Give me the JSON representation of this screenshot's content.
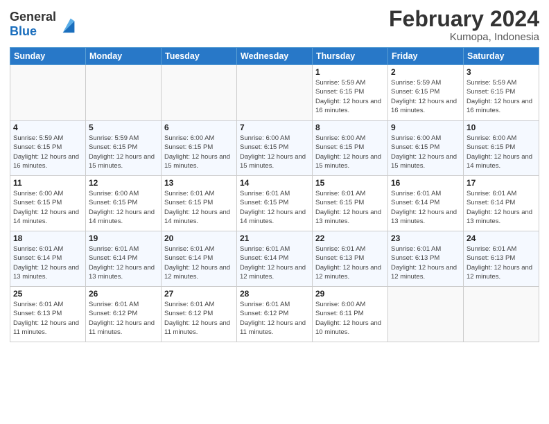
{
  "header": {
    "logo_line1": "General",
    "logo_line2": "Blue",
    "month_year": "February 2024",
    "location": "Kumopa, Indonesia"
  },
  "weekdays": [
    "Sunday",
    "Monday",
    "Tuesday",
    "Wednesday",
    "Thursday",
    "Friday",
    "Saturday"
  ],
  "weeks": [
    [
      {
        "day": "",
        "sunrise": "",
        "sunset": "",
        "daylight": ""
      },
      {
        "day": "",
        "sunrise": "",
        "sunset": "",
        "daylight": ""
      },
      {
        "day": "",
        "sunrise": "",
        "sunset": "",
        "daylight": ""
      },
      {
        "day": "",
        "sunrise": "",
        "sunset": "",
        "daylight": ""
      },
      {
        "day": "1",
        "sunrise": "Sunrise: 5:59 AM",
        "sunset": "Sunset: 6:15 PM",
        "daylight": "Daylight: 12 hours and 16 minutes."
      },
      {
        "day": "2",
        "sunrise": "Sunrise: 5:59 AM",
        "sunset": "Sunset: 6:15 PM",
        "daylight": "Daylight: 12 hours and 16 minutes."
      },
      {
        "day": "3",
        "sunrise": "Sunrise: 5:59 AM",
        "sunset": "Sunset: 6:15 PM",
        "daylight": "Daylight: 12 hours and 16 minutes."
      }
    ],
    [
      {
        "day": "4",
        "sunrise": "Sunrise: 5:59 AM",
        "sunset": "Sunset: 6:15 PM",
        "daylight": "Daylight: 12 hours and 16 minutes."
      },
      {
        "day": "5",
        "sunrise": "Sunrise: 5:59 AM",
        "sunset": "Sunset: 6:15 PM",
        "daylight": "Daylight: 12 hours and 15 minutes."
      },
      {
        "day": "6",
        "sunrise": "Sunrise: 6:00 AM",
        "sunset": "Sunset: 6:15 PM",
        "daylight": "Daylight: 12 hours and 15 minutes."
      },
      {
        "day": "7",
        "sunrise": "Sunrise: 6:00 AM",
        "sunset": "Sunset: 6:15 PM",
        "daylight": "Daylight: 12 hours and 15 minutes."
      },
      {
        "day": "8",
        "sunrise": "Sunrise: 6:00 AM",
        "sunset": "Sunset: 6:15 PM",
        "daylight": "Daylight: 12 hours and 15 minutes."
      },
      {
        "day": "9",
        "sunrise": "Sunrise: 6:00 AM",
        "sunset": "Sunset: 6:15 PM",
        "daylight": "Daylight: 12 hours and 15 minutes."
      },
      {
        "day": "10",
        "sunrise": "Sunrise: 6:00 AM",
        "sunset": "Sunset: 6:15 PM",
        "daylight": "Daylight: 12 hours and 14 minutes."
      }
    ],
    [
      {
        "day": "11",
        "sunrise": "Sunrise: 6:00 AM",
        "sunset": "Sunset: 6:15 PM",
        "daylight": "Daylight: 12 hours and 14 minutes."
      },
      {
        "day": "12",
        "sunrise": "Sunrise: 6:00 AM",
        "sunset": "Sunset: 6:15 PM",
        "daylight": "Daylight: 12 hours and 14 minutes."
      },
      {
        "day": "13",
        "sunrise": "Sunrise: 6:01 AM",
        "sunset": "Sunset: 6:15 PM",
        "daylight": "Daylight: 12 hours and 14 minutes."
      },
      {
        "day": "14",
        "sunrise": "Sunrise: 6:01 AM",
        "sunset": "Sunset: 6:15 PM",
        "daylight": "Daylight: 12 hours and 14 minutes."
      },
      {
        "day": "15",
        "sunrise": "Sunrise: 6:01 AM",
        "sunset": "Sunset: 6:15 PM",
        "daylight": "Daylight: 12 hours and 13 minutes."
      },
      {
        "day": "16",
        "sunrise": "Sunrise: 6:01 AM",
        "sunset": "Sunset: 6:14 PM",
        "daylight": "Daylight: 12 hours and 13 minutes."
      },
      {
        "day": "17",
        "sunrise": "Sunrise: 6:01 AM",
        "sunset": "Sunset: 6:14 PM",
        "daylight": "Daylight: 12 hours and 13 minutes."
      }
    ],
    [
      {
        "day": "18",
        "sunrise": "Sunrise: 6:01 AM",
        "sunset": "Sunset: 6:14 PM",
        "daylight": "Daylight: 12 hours and 13 minutes."
      },
      {
        "day": "19",
        "sunrise": "Sunrise: 6:01 AM",
        "sunset": "Sunset: 6:14 PM",
        "daylight": "Daylight: 12 hours and 13 minutes."
      },
      {
        "day": "20",
        "sunrise": "Sunrise: 6:01 AM",
        "sunset": "Sunset: 6:14 PM",
        "daylight": "Daylight: 12 hours and 12 minutes."
      },
      {
        "day": "21",
        "sunrise": "Sunrise: 6:01 AM",
        "sunset": "Sunset: 6:14 PM",
        "daylight": "Daylight: 12 hours and 12 minutes."
      },
      {
        "day": "22",
        "sunrise": "Sunrise: 6:01 AM",
        "sunset": "Sunset: 6:13 PM",
        "daylight": "Daylight: 12 hours and 12 minutes."
      },
      {
        "day": "23",
        "sunrise": "Sunrise: 6:01 AM",
        "sunset": "Sunset: 6:13 PM",
        "daylight": "Daylight: 12 hours and 12 minutes."
      },
      {
        "day": "24",
        "sunrise": "Sunrise: 6:01 AM",
        "sunset": "Sunset: 6:13 PM",
        "daylight": "Daylight: 12 hours and 12 minutes."
      }
    ],
    [
      {
        "day": "25",
        "sunrise": "Sunrise: 6:01 AM",
        "sunset": "Sunset: 6:13 PM",
        "daylight": "Daylight: 12 hours and 11 minutes."
      },
      {
        "day": "26",
        "sunrise": "Sunrise: 6:01 AM",
        "sunset": "Sunset: 6:12 PM",
        "daylight": "Daylight: 12 hours and 11 minutes."
      },
      {
        "day": "27",
        "sunrise": "Sunrise: 6:01 AM",
        "sunset": "Sunset: 6:12 PM",
        "daylight": "Daylight: 12 hours and 11 minutes."
      },
      {
        "day": "28",
        "sunrise": "Sunrise: 6:01 AM",
        "sunset": "Sunset: 6:12 PM",
        "daylight": "Daylight: 12 hours and 11 minutes."
      },
      {
        "day": "29",
        "sunrise": "Sunrise: 6:00 AM",
        "sunset": "Sunset: 6:11 PM",
        "daylight": "Daylight: 12 hours and 10 minutes."
      },
      {
        "day": "",
        "sunrise": "",
        "sunset": "",
        "daylight": ""
      },
      {
        "day": "",
        "sunrise": "",
        "sunset": "",
        "daylight": ""
      }
    ]
  ]
}
